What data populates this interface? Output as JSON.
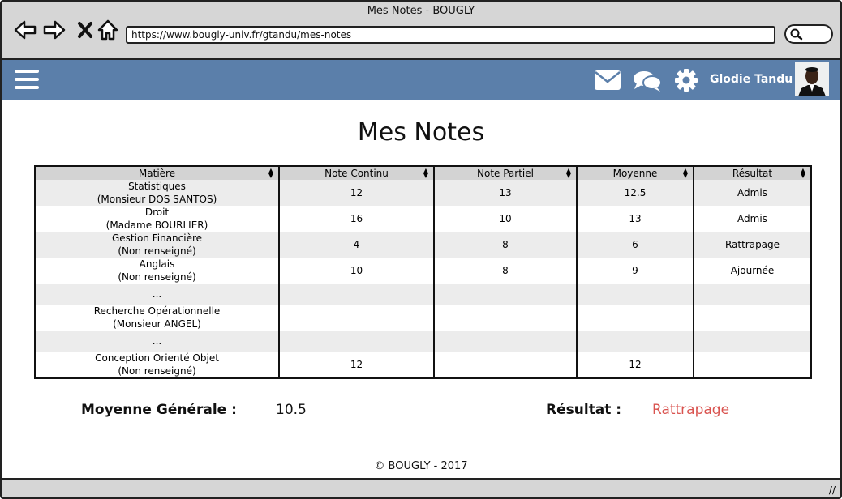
{
  "window": {
    "title": "Mes Notes - BOUGLY"
  },
  "browser": {
    "url": "https://www.bougly-univ.fr/gtandu/mes-notes"
  },
  "appbar": {
    "username": "Glodie Tandu",
    "color": "#5b7faa"
  },
  "page": {
    "title": "Mes Notes"
  },
  "table": {
    "headers": [
      "Matière",
      "Note Continu",
      "Note Partiel",
      "Moyenne",
      "Résultat"
    ],
    "rows": [
      {
        "subject": "Statistiques",
        "teacher": "(Monsieur DOS SANTOS)",
        "continu": "12",
        "partiel": "13",
        "moyenne": "12.5",
        "resultat": "Admis"
      },
      {
        "subject": "Droit",
        "teacher": "(Madame BOURLIER)",
        "continu": "16",
        "partiel": "10",
        "moyenne": "13",
        "resultat": "Admis"
      },
      {
        "subject": "Gestion Financière",
        "teacher": "(Non renseigné)",
        "continu": "4",
        "partiel": "8",
        "moyenne": "6",
        "resultat": "Rattrapage"
      },
      {
        "subject": "Anglais",
        "teacher": "(Non renseigné)",
        "continu": "10",
        "partiel": "8",
        "moyenne": "9",
        "resultat": "Ajournée"
      },
      {
        "ellipsis": "..."
      },
      {
        "subject": "Recherche Opérationnelle",
        "teacher": "(Monsieur ANGEL)",
        "continu": "-",
        "partiel": "-",
        "moyenne": "-",
        "resultat": "-"
      },
      {
        "ellipsis": "..."
      },
      {
        "subject": "Conception Orienté Objet",
        "teacher": "(Non renseigné)",
        "continu": "12",
        "partiel": "-",
        "moyenne": "12",
        "resultat": "-"
      }
    ]
  },
  "summary": {
    "average_label": "Moyenne Générale :",
    "average_value": "10.5",
    "result_label": "Résultat :",
    "result_value": "Rattrapage",
    "result_color": "#d9534f"
  },
  "footer": {
    "text": "© BOUGLY - 2017"
  }
}
